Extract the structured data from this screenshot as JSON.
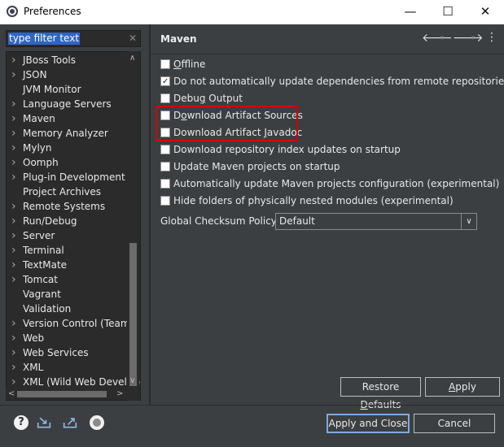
{
  "window": {
    "title": "Preferences",
    "minimize": "—",
    "maximize": "☐",
    "close": "✕"
  },
  "filter": {
    "value": "type filter text",
    "clear": "✕"
  },
  "tree": {
    "items": [
      {
        "label": "JBoss Tools",
        "expandable": true
      },
      {
        "label": "JSON",
        "expandable": true
      },
      {
        "label": "JVM Monitor",
        "expandable": false
      },
      {
        "label": "Language Servers",
        "expandable": true
      },
      {
        "label": "Maven",
        "expandable": true
      },
      {
        "label": "Memory Analyzer",
        "expandable": true
      },
      {
        "label": "Mylyn",
        "expandable": true
      },
      {
        "label": "Oomph",
        "expandable": true
      },
      {
        "label": "Plug-in Development",
        "expandable": true
      },
      {
        "label": "Project Archives",
        "expandable": false
      },
      {
        "label": "Remote Systems",
        "expandable": true
      },
      {
        "label": "Run/Debug",
        "expandable": true
      },
      {
        "label": "Server",
        "expandable": true
      },
      {
        "label": "Terminal",
        "expandable": true
      },
      {
        "label": "TextMate",
        "expandable": true
      },
      {
        "label": "Tomcat",
        "expandable": true
      },
      {
        "label": "Vagrant",
        "expandable": false
      },
      {
        "label": "Validation",
        "expandable": false
      },
      {
        "label": "Version Control (Team)",
        "expandable": true
      },
      {
        "label": "Web",
        "expandable": true
      },
      {
        "label": "Web Services",
        "expandable": true
      },
      {
        "label": "XML",
        "expandable": true
      },
      {
        "label": "XML (Wild Web Developer)",
        "expandable": true
      }
    ]
  },
  "page": {
    "title": "Maven",
    "back_icon": "🡐",
    "forward_icon": "🡒",
    "menu_icon": "⋮",
    "dropdown_icon": "▾"
  },
  "options": [
    {
      "pre": "",
      "mn": "O",
      "post": "ffline",
      "checked": false
    },
    {
      "pre": "Do not automatically update dependencies from remote repositories",
      "mn": "",
      "post": "",
      "checked": true
    },
    {
      "pre": "Debu",
      "mn": "g",
      "post": " Output",
      "checked": false
    },
    {
      "pre": "D",
      "mn": "o",
      "post": "wnload Artifact Sources",
      "checked": false
    },
    {
      "pre": "Download Artifact ",
      "mn": "J",
      "post": "avadoc",
      "checked": false
    },
    {
      "pre": "Download repository index updates on startup",
      "mn": "",
      "post": "",
      "checked": false
    },
    {
      "pre": "Update Maven projects on startup",
      "mn": "",
      "post": "",
      "checked": false
    },
    {
      "pre": "Automatically update Maven projects configuration (experimental)",
      "mn": "",
      "post": "",
      "checked": false
    },
    {
      "pre": "Hide folders of physically nested modules (experimental)",
      "mn": "",
      "post": "",
      "checked": false
    }
  ],
  "checksum": {
    "label": "Global Checksum Policy:",
    "value": "Default",
    "arrow": "∨"
  },
  "buttons": {
    "restore_pre": "Restore ",
    "restore_mn": "D",
    "restore_post": "efaults",
    "apply_mn": "A",
    "apply_post": "pply",
    "apply_close": "Apply and Close",
    "cancel": "Cancel"
  },
  "bottom_icons": {
    "help": "?"
  },
  "colors": {
    "background": "#3c3f41",
    "tree_background": "#2b2b2b",
    "selection": "#2f65ca",
    "highlight_box": "#d40000",
    "default_button_border": "#7eaae0"
  }
}
